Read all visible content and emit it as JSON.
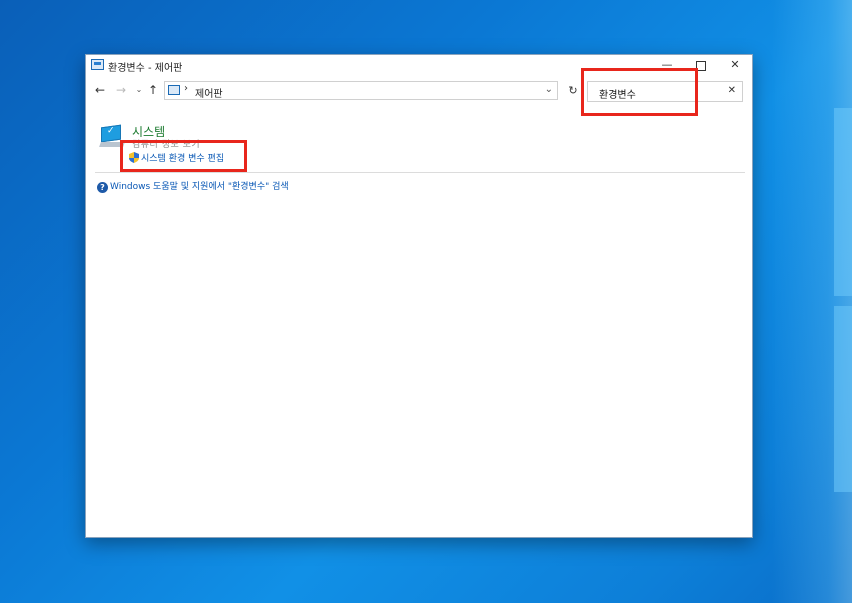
{
  "window": {
    "title": "환경변수 - 제어판",
    "minimize_glyph": "—",
    "close_glyph": "✕"
  },
  "navigation": {
    "back_glyph": "←",
    "forward_glyph": "→",
    "recent_glyph": "⌄",
    "up_glyph": "↑",
    "address_separator": "›",
    "address_text": "제어판",
    "address_dropdown_glyph": "⌄",
    "refresh_glyph": "↻",
    "search_value": "환경변수",
    "search_clear_glyph": "✕"
  },
  "results": {
    "category_title": "시스템",
    "category_subtitle": "컴퓨터 정보 보기",
    "task_link": "시스템 환경 변수 편집",
    "help_icon_glyph": "?",
    "help_link": "Windows 도움말 및 지원에서 \"환경변수\" 검색"
  },
  "colors": {
    "highlight": "#e8261c",
    "link": "#0a58b5",
    "category_title": "#1a7a2e"
  }
}
